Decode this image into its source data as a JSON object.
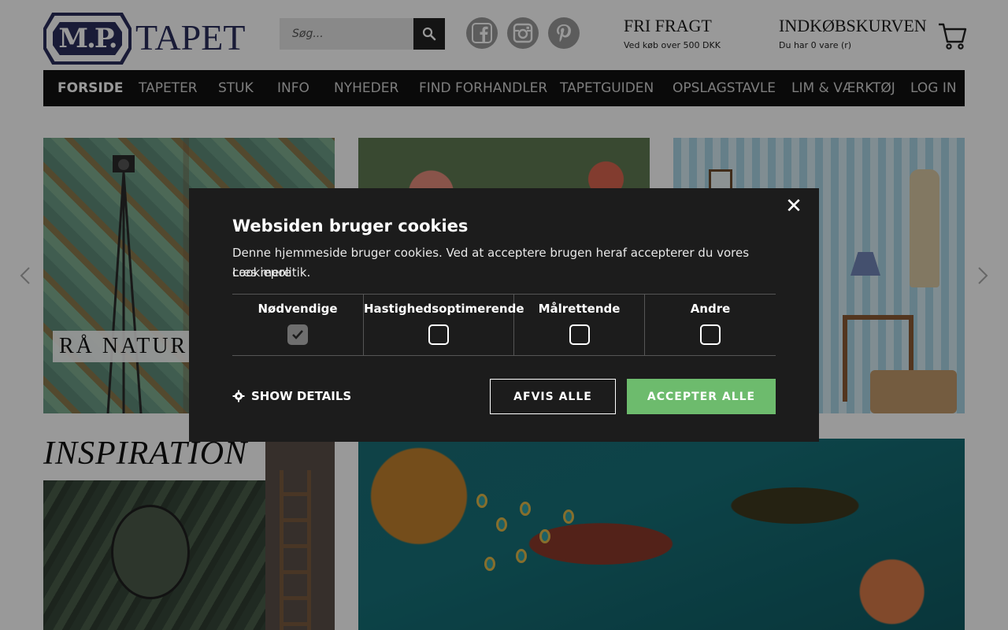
{
  "header": {
    "logo_badge": "M.P.",
    "logo_word": "TAPET",
    "search_placeholder": "Søg...",
    "social": [
      "facebook-icon",
      "instagram-icon",
      "pinterest-icon"
    ],
    "freight_title": "FRI FRAGT",
    "freight_sub": "Ved køb over 500 DKK",
    "cart_title": "INDKØBSKURVEN",
    "cart_sub": "Du har 0 vare (r)"
  },
  "nav": {
    "items": [
      {
        "label": "FORSIDE",
        "active": true
      },
      {
        "label": "TAPETER"
      },
      {
        "label": "STUK"
      },
      {
        "label": "INFO"
      },
      {
        "label": "NYHEDER"
      },
      {
        "label": "FIND FORHANDLER"
      },
      {
        "label": "TAPETGUIDEN"
      },
      {
        "label": "OPSLAGSTAVLE"
      },
      {
        "label": "LIM & VÆRKTØJ"
      },
      {
        "label": "LOG IN"
      }
    ]
  },
  "content": {
    "slide_label": "RÅ  NATUR",
    "inspiration_heading": "INSPIRATION"
  },
  "cookie": {
    "title": "Websiden bruger cookies",
    "text": "Denne hjemmeside bruger cookies. Ved at acceptere brugen heraf accepterer du vores cookiepolitik.",
    "read_more": "Læs mere",
    "categories": [
      {
        "label": "Nødvendige",
        "checked": true
      },
      {
        "label": "Hastighedsoptimerende",
        "checked": false
      },
      {
        "label": "Målrettende",
        "checked": false
      },
      {
        "label": "Andre",
        "checked": false
      }
    ],
    "show_details": "SHOW DETAILS",
    "reject_all": "AFVIS ALLE",
    "accept_all": "ACCEPTER ALLE",
    "close": "✕"
  },
  "colors": {
    "brand_navy": "#2b2d5c",
    "nav_bg": "#111111",
    "dialog_bg": "#1c1c1c",
    "accept_green": "#6dbb6d"
  }
}
